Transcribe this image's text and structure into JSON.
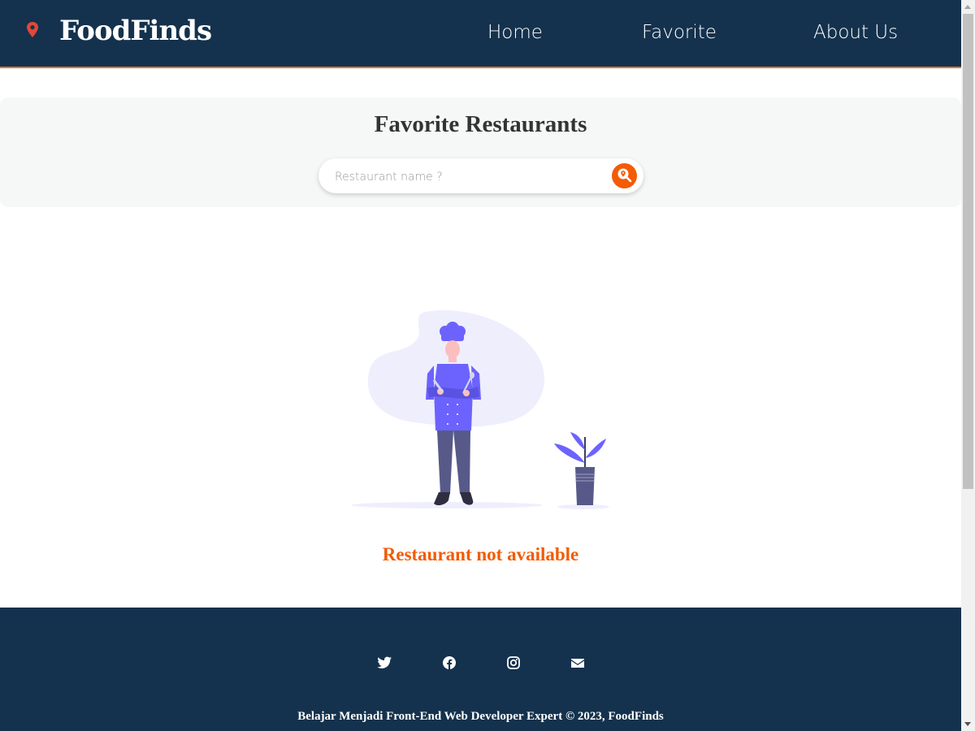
{
  "header": {
    "brand": "FoodFinds",
    "nav": [
      {
        "label": "Home"
      },
      {
        "label": "Favorite"
      },
      {
        "label": "About Us"
      }
    ]
  },
  "hero": {
    "title": "Favorite Restaurants",
    "search_placeholder": "Restaurant name ?"
  },
  "empty_state": {
    "message": "Restaurant not available",
    "illustration": "chef-with-plant"
  },
  "footer": {
    "social": [
      "twitter-icon",
      "facebook-icon",
      "instagram-icon",
      "email-icon"
    ],
    "copyright": "Belajar Menjadi Front-End Web Developer Expert © 2023, FoodFinds"
  },
  "colors": {
    "header_bg": "#14324d",
    "accent": "#f35b04",
    "header_border": "#e3732a",
    "pin": "#e0483a"
  }
}
